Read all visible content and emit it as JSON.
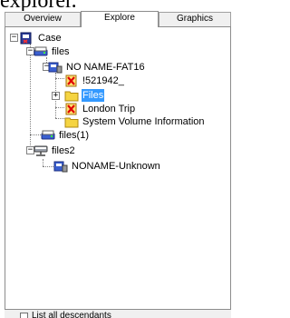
{
  "caption": "explorer.",
  "tabs": [
    {
      "label": "Overview",
      "active": false
    },
    {
      "label": "Explore",
      "active": true
    },
    {
      "label": "Graphics",
      "active": false
    }
  ],
  "tree": {
    "case": {
      "label": "Case",
      "expanded": true,
      "icon": "case-icon"
    },
    "files": {
      "label": "files",
      "expanded": true,
      "icon": "drive-icon"
    },
    "nonameFat16": {
      "label": "NO NAME-FAT16",
      "expanded": true,
      "icon": "volume-icon"
    },
    "item521942": {
      "label": "!521942_",
      "icon": "deleted-file-icon"
    },
    "filesFolder": {
      "label": "Files",
      "expanded": false,
      "selected": true,
      "icon": "folder-icon"
    },
    "londonTrip": {
      "label": "London Trip",
      "icon": "deleted-file-icon"
    },
    "systemVolume": {
      "label": "System Volume Information",
      "icon": "folder-icon"
    },
    "files1": {
      "label": "files(1)",
      "icon": "drive-icon"
    },
    "files2": {
      "label": "files2",
      "expanded": true,
      "icon": "network-drive-icon"
    },
    "nonameUnknown": {
      "label": "NONAME-Unknown",
      "icon": "volume-icon"
    }
  },
  "status": {
    "checkbox_label": "List all descendants",
    "checked": false
  },
  "colors": {
    "selection": "#3399ff",
    "tab_background": "#f0f0f0",
    "border": "#8c8c8c"
  }
}
